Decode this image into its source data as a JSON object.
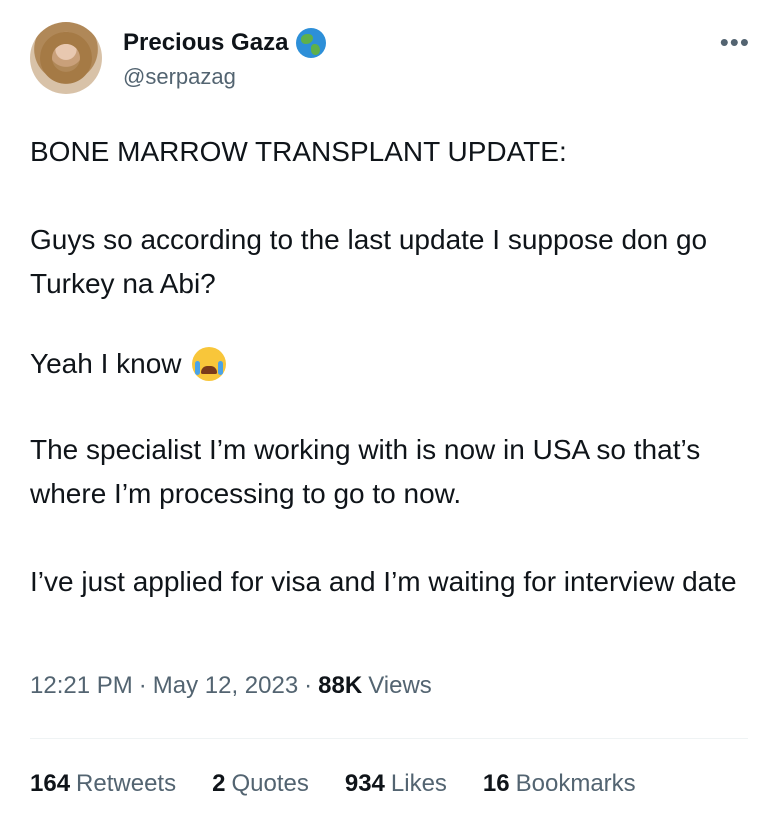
{
  "author": {
    "name": "Precious Gaza",
    "handle": "@serpazag",
    "badge_icon": "globe-icon"
  },
  "tweet": {
    "paragraphs": [
      "BONE MARROW TRANSPLANT UPDATE:",
      "Guys so according to the last update I suppose don go Turkey na Abi?",
      "Yeah I know",
      "The specialist I’m working with is now in USA so that’s where I’m processing to go to now.",
      "I’ve just applied for visa and I’m waiting for interview date"
    ],
    "emoji": "crying-face-icon"
  },
  "meta": {
    "time": "12:21 PM",
    "separator": "·",
    "date": "May 12, 2023",
    "views_count": "88K",
    "views_label": "Views"
  },
  "stats": [
    {
      "count": "164",
      "label": "Retweets"
    },
    {
      "count": "2",
      "label": "Quotes"
    },
    {
      "count": "934",
      "label": "Likes"
    },
    {
      "count": "16",
      "label": "Bookmarks"
    }
  ],
  "colors": {
    "text": "#0f1419",
    "secondary": "#536471",
    "divider": "#eff3f4"
  }
}
